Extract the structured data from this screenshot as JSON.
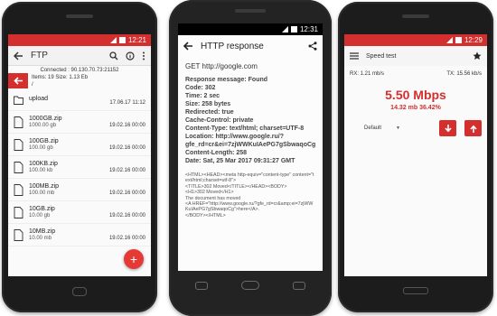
{
  "phone1": {
    "status_time": "12:21",
    "title": "FTP",
    "connected": "Connected : 90.130.70.73:21152",
    "items": "Items: 19 Size: 1.13 Eb",
    "path": "/",
    "files": [
      {
        "name": "upload",
        "size": "",
        "date": "17.06.17 11:12",
        "kind": "folder"
      },
      {
        "name": "1000GB.zip",
        "size": "1000.00 gb",
        "date": "19.02.16 00:00",
        "kind": "file"
      },
      {
        "name": "100GB.zip",
        "size": "100.00 gb",
        "date": "19.02.16 00:00",
        "kind": "file"
      },
      {
        "name": "100KB.zip",
        "size": "100.00 kb",
        "date": "19.02.16 00:00",
        "kind": "file"
      },
      {
        "name": "100MB.zip",
        "size": "100.00 mb",
        "date": "19.02.16 00:00",
        "kind": "file"
      },
      {
        "name": "10GB.zip",
        "size": "10.00 gb",
        "date": "19.02.16 00:00",
        "kind": "file"
      },
      {
        "name": "10MB.zip",
        "size": "10.00 mb",
        "date": "19.02.16 00:00",
        "kind": "file"
      }
    ],
    "fab": "+"
  },
  "phone2": {
    "status_time": "12:31",
    "title": "HTTP response",
    "request": "GET http://google.com",
    "lines": [
      "Response message: Found",
      "Code: 302",
      "Time: 2 sec",
      "Size: 258 bytes",
      "Redirected: true",
      "Cache-Control: private",
      "Content-Type: text/html; charset=UTF-8",
      "Location: http://www.google.ru/?gfe_rd=cr&ei=7zjWWKuIAePG7gSbwaqoCg",
      "Content-Length: 258",
      "Date: Sat, 25 Mar 2017 09:31:27 GMT"
    ],
    "raw": "<HTML><HEAD><meta http-equiv=\"content-type\" content=\"text/html;charset=utf-8\">\n<TITLE>302 Moved</TITLE></HEAD><BODY>\n<H1>302 Moved</H1>\nThe document has moved\n<A HREF=\"http://www.google.ru/?gfe_rd=cr&amp;ei=7zjWWKuIAePG7gSbwaqoCg\">here</A>.\n</BODY></HTML>"
  },
  "phone3": {
    "status_time": "12:29",
    "title": "Speed test",
    "rx": "RX: 1.21 mb/s",
    "tx": "TX: 15.56 kb/s",
    "speed": "5.50 Mbps",
    "detail": "14.32 mb 36.42%",
    "select_value": "Default"
  },
  "colors": {
    "accent": "#d32f2f",
    "fab": "#e53935",
    "phone_body": "#1c1c1c"
  },
  "icons": [
    "back-arrow-icon",
    "search-icon",
    "info-icon",
    "more-vert-icon",
    "folder-icon",
    "file-icon",
    "share-icon",
    "menu-icon",
    "star-icon",
    "download-icon",
    "upload-icon"
  ]
}
